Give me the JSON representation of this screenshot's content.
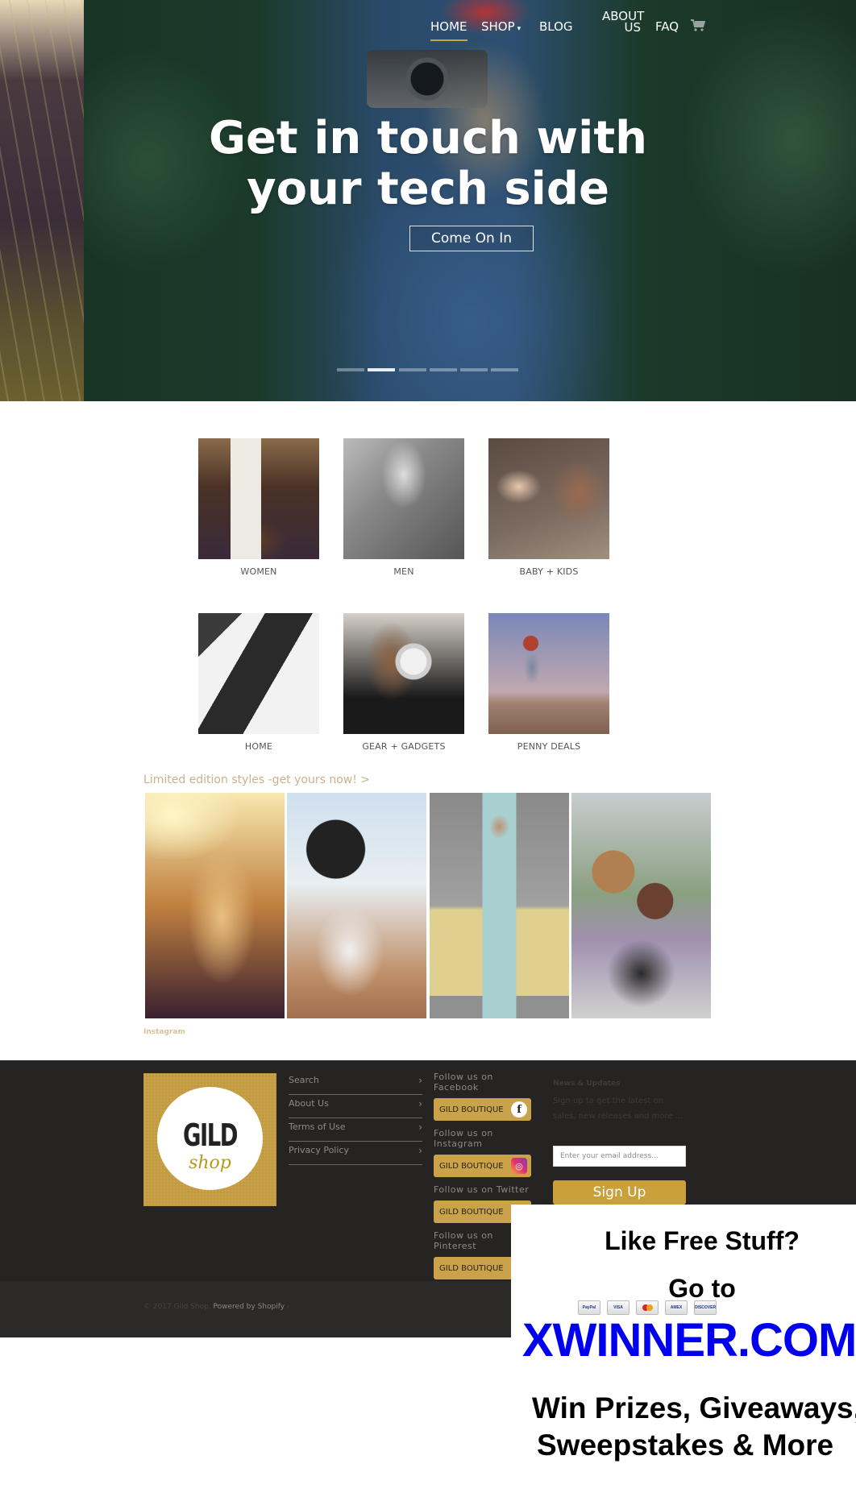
{
  "nav": {
    "items": [
      {
        "label": "HOME",
        "active": true
      },
      {
        "label": "SHOP",
        "has_dropdown": true,
        "caret": "▾"
      },
      {
        "label": "BLOG"
      },
      {
        "label_line1": "ABOUT",
        "label_line2": "US"
      },
      {
        "label": "FAQ"
      }
    ],
    "cart_icon": "cart-icon"
  },
  "hero": {
    "title_line1": "Get in touch with",
    "title_line2": "your tech side",
    "cta_label": "Come On In",
    "slides_count": 6,
    "active_slide": 2
  },
  "categories": [
    {
      "label": "WOMEN"
    },
    {
      "label": "MEN"
    },
    {
      "label": "BABY + KIDS"
    },
    {
      "label": "HOME"
    },
    {
      "label": "GEAR + GADGETS"
    },
    {
      "label": "PENNY DEALS"
    }
  ],
  "limited": {
    "link_text": "Limited edition styles -get yours now! >",
    "instagram_label": "Instagram"
  },
  "footer": {
    "logo": {
      "line1": "GILD",
      "line2": "shop"
    },
    "links": [
      {
        "label": "Search",
        "chevron": "›"
      },
      {
        "label": "About Us",
        "chevron": "›"
      },
      {
        "label": "Terms of Use",
        "chevron": "›"
      },
      {
        "label": "Privacy Policy",
        "chevron": "›"
      }
    ],
    "social": [
      {
        "label": "Follow us on Facebook",
        "button": "GILD BOUTIQUE",
        "icon_glyph": "f"
      },
      {
        "label": "Follow us on Instagram",
        "button": "GILD BOUTIQUE",
        "icon_glyph": "◎"
      },
      {
        "label": "Follow us on Twitter",
        "button": "GILD BOUTIQUE",
        "icon_glyph": ""
      },
      {
        "label": "Follow us on Pinterest",
        "button": "GILD BOUTIQUE",
        "icon_glyph": "p"
      }
    ],
    "news": {
      "title": "News & Updates",
      "text": "Sign up to get the latest on sales, new releases and more ...",
      "email_placeholder": "Enter your email address...",
      "signup_label": "Sign Up"
    },
    "copyright": "© 2017 Gild Shop.",
    "powered": "Powered by Shopify",
    "powered_suffix": "›"
  },
  "ad": {
    "line1": "Like Free Stuff?",
    "line2": "Go to",
    "payment_cards": [
      "PayPal",
      "VISA",
      "MasterCard",
      "AMERICAN EXPRESS",
      "DISCOVER"
    ],
    "brand": "XWINNER.COM",
    "line3": "Win Prizes, Giveaways,",
    "line4": "Sweepstakes & More"
  },
  "colors": {
    "accent_gold": "#c9a24a",
    "footer_bg": "#252423",
    "ad_brand_blue": "#0000ee"
  }
}
